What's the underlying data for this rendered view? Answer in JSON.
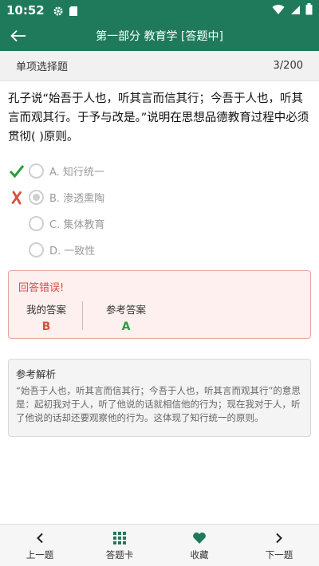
{
  "status_bar": {
    "time": "10:52",
    "icons": [
      "gear-icon",
      "sd-card-icon",
      "wifi-icon",
      "signal-icon",
      "battery-icon"
    ]
  },
  "app_bar": {
    "title": "第一部分 教育学 [答题中]",
    "back_icon": "arrow-left-icon"
  },
  "sub_header": {
    "question_type": "单项选择题",
    "progress": "3/200"
  },
  "question": {
    "text": "孔子说“始吾于人也，听其言而信其行；今吾于人也，听其言而观其行。于予与改是。”说明在思想品德教育过程中必须贯彻( )原则。"
  },
  "options": [
    {
      "label": "A. 知行统一",
      "state": "correct",
      "mark_icon": "check-icon",
      "selected": false
    },
    {
      "label": "B. 渗透熏陶",
      "state": "wrong",
      "mark_icon": "cross-icon",
      "selected": true
    },
    {
      "label": "C. 集体教育",
      "state": "none",
      "mark_icon": "",
      "selected": false
    },
    {
      "label": "D. 一致性",
      "state": "none",
      "mark_icon": "",
      "selected": false
    }
  ],
  "result": {
    "title": "回答错误!",
    "my_answer_label": "我的答案",
    "my_answer": "B",
    "ref_answer_label": "参考答案",
    "ref_answer": "A"
  },
  "analysis": {
    "title": "参考解析",
    "body": "“始吾于人也，听其言而信其行；今吾于人也，听其言而观其行”的意思是：起初我对于人，听了他说的话就相信他的行为；现在我对于人，听了他说的话却还要观察他的行为。这体现了知行统一的原则。"
  },
  "bottom_nav": [
    {
      "label": "上一题",
      "icon": "chevron-left-icon"
    },
    {
      "label": "答题卡",
      "icon": "grid-icon"
    },
    {
      "label": "收藏",
      "icon": "heart-icon"
    },
    {
      "label": "下一题",
      "icon": "chevron-right-icon"
    }
  ],
  "colors": {
    "primary": "#1f7a5c",
    "correct": "#2a9d3c",
    "wrong": "#d8503f",
    "result_bg": "#fdf0ee"
  }
}
